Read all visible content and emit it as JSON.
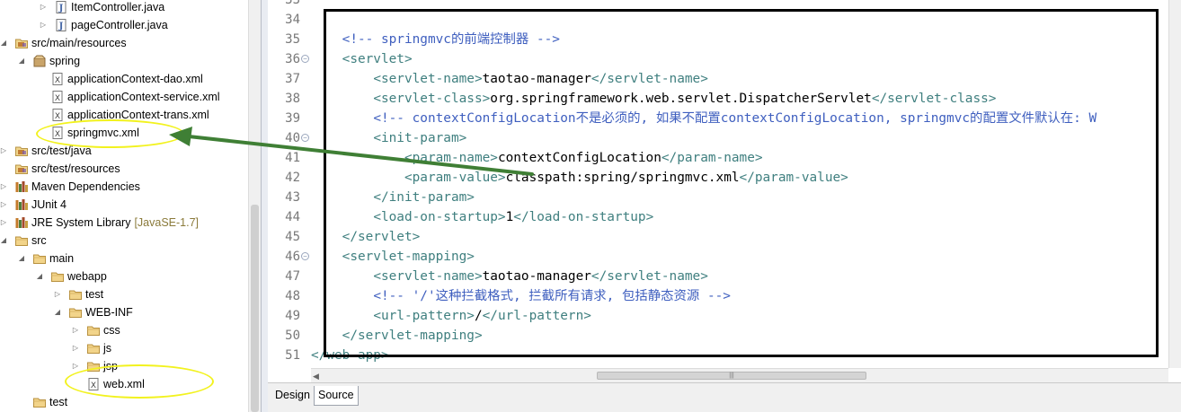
{
  "project_tree": {
    "items": [
      {
        "label": "ItemController.java",
        "icon": "java-file-icon",
        "twisty": "expand",
        "deco": ""
      },
      {
        "label": "pageController.java",
        "icon": "java-file-icon",
        "twisty": "expand",
        "deco": ""
      },
      {
        "label": "src/main/resources",
        "icon": "source-folder-icon",
        "twisty": "collapse",
        "deco": ""
      },
      {
        "label": "spring",
        "icon": "package-icon",
        "twisty": "collapse",
        "deco": ""
      },
      {
        "label": "applicationContext-dao.xml",
        "icon": "xml-file-icon",
        "twisty": "",
        "deco": ""
      },
      {
        "label": "applicationContext-service.xml",
        "icon": "xml-file-icon",
        "twisty": "",
        "deco": ""
      },
      {
        "label": "applicationContext-trans.xml",
        "icon": "xml-file-icon",
        "twisty": "",
        "deco": ""
      },
      {
        "label": "springmvc.xml",
        "icon": "xml-file-icon",
        "twisty": "",
        "deco": ""
      },
      {
        "label": "src/test/java",
        "icon": "source-folder-icon",
        "twisty": "expand",
        "deco": ""
      },
      {
        "label": "src/test/resources",
        "icon": "source-folder-icon",
        "twisty": "",
        "deco": ""
      },
      {
        "label": "Maven Dependencies",
        "icon": "library-icon",
        "twisty": "expand",
        "deco": ""
      },
      {
        "label": "JUnit 4",
        "icon": "library-icon",
        "twisty": "expand",
        "deco": ""
      },
      {
        "label": "JRE System Library",
        "icon": "library-icon",
        "twisty": "expand",
        "deco": "[JavaSE-1.7]"
      },
      {
        "label": "src",
        "icon": "folder-icon",
        "twisty": "collapse",
        "deco": ""
      },
      {
        "label": "main",
        "icon": "folder-icon",
        "twisty": "collapse",
        "deco": ""
      },
      {
        "label": "webapp",
        "icon": "folder-icon",
        "twisty": "collapse",
        "deco": ""
      },
      {
        "label": "test",
        "icon": "folder-icon",
        "twisty": "expand",
        "deco": ""
      },
      {
        "label": "WEB-INF",
        "icon": "folder-icon",
        "twisty": "collapse",
        "deco": ""
      },
      {
        "label": "css",
        "icon": "folder-icon",
        "twisty": "expand",
        "deco": ""
      },
      {
        "label": "js",
        "icon": "folder-icon",
        "twisty": "expand",
        "deco": ""
      },
      {
        "label": "jsp",
        "icon": "folder-icon",
        "twisty": "expand",
        "deco": ""
      },
      {
        "label": "web.xml",
        "icon": "xml-file-icon",
        "twisty": "",
        "deco": ""
      },
      {
        "label": "test",
        "icon": "folder-icon",
        "twisty": "",
        "deco": ""
      }
    ]
  },
  "editor": {
    "lines": [
      {
        "num": "33",
        "fold": false,
        "code": []
      },
      {
        "num": "34",
        "fold": false,
        "code": []
      },
      {
        "num": "35",
        "fold": false,
        "code": [
          {
            "t": "    ",
            "c": "tx"
          },
          {
            "t": "<!-- springmvc的前端控制器 -->",
            "c": "cm"
          }
        ]
      },
      {
        "num": "36",
        "fold": true,
        "code": [
          {
            "t": "    ",
            "c": "tx"
          },
          {
            "t": "<servlet>",
            "c": "tg"
          }
        ]
      },
      {
        "num": "37",
        "fold": false,
        "code": [
          {
            "t": "        ",
            "c": "tx"
          },
          {
            "t": "<servlet-name>",
            "c": "tg"
          },
          {
            "t": "taotao-manager",
            "c": "tx"
          },
          {
            "t": "</servlet-name>",
            "c": "tg"
          }
        ]
      },
      {
        "num": "38",
        "fold": false,
        "code": [
          {
            "t": "        ",
            "c": "tx"
          },
          {
            "t": "<servlet-class>",
            "c": "tg"
          },
          {
            "t": "org.springframework.web.servlet.DispatcherServlet",
            "c": "tx"
          },
          {
            "t": "</servlet-class>",
            "c": "tg"
          }
        ]
      },
      {
        "num": "39",
        "fold": false,
        "code": [
          {
            "t": "        ",
            "c": "tx"
          },
          {
            "t": "<!-- contextConfigLocation不是必须的, 如果不配置contextConfigLocation, springmvc的配置文件默认在: W",
            "c": "cm"
          }
        ]
      },
      {
        "num": "40",
        "fold": true,
        "code": [
          {
            "t": "        ",
            "c": "tx"
          },
          {
            "t": "<init-param>",
            "c": "tg"
          }
        ]
      },
      {
        "num": "41",
        "fold": false,
        "code": [
          {
            "t": "            ",
            "c": "tx"
          },
          {
            "t": "<param-name>",
            "c": "tg"
          },
          {
            "t": "contextConfigLocation",
            "c": "tx"
          },
          {
            "t": "</param-name>",
            "c": "tg"
          }
        ]
      },
      {
        "num": "42",
        "fold": false,
        "code": [
          {
            "t": "            ",
            "c": "tx"
          },
          {
            "t": "<param-value>",
            "c": "tg"
          },
          {
            "t": "classpath:spring/springmvc.xml",
            "c": "tx"
          },
          {
            "t": "</param-value>",
            "c": "tg"
          }
        ]
      },
      {
        "num": "43",
        "fold": false,
        "code": [
          {
            "t": "        ",
            "c": "tx"
          },
          {
            "t": "</init-param>",
            "c": "tg"
          }
        ]
      },
      {
        "num": "44",
        "fold": false,
        "code": [
          {
            "t": "        ",
            "c": "tx"
          },
          {
            "t": "<load-on-startup>",
            "c": "tg"
          },
          {
            "t": "1",
            "c": "tx"
          },
          {
            "t": "</load-on-startup>",
            "c": "tg"
          }
        ]
      },
      {
        "num": "45",
        "fold": false,
        "code": [
          {
            "t": "    ",
            "c": "tx"
          },
          {
            "t": "</servlet>",
            "c": "tg"
          }
        ]
      },
      {
        "num": "46",
        "fold": true,
        "code": [
          {
            "t": "    ",
            "c": "tx"
          },
          {
            "t": "<servlet-mapping>",
            "c": "tg"
          }
        ]
      },
      {
        "num": "47",
        "fold": false,
        "code": [
          {
            "t": "        ",
            "c": "tx"
          },
          {
            "t": "<servlet-name>",
            "c": "tg"
          },
          {
            "t": "taotao-manager",
            "c": "tx"
          },
          {
            "t": "</servlet-name>",
            "c": "tg"
          }
        ]
      },
      {
        "num": "48",
        "fold": false,
        "code": [
          {
            "t": "        ",
            "c": "tx"
          },
          {
            "t": "<!-- '/'这种拦截格式, 拦截所有请求, 包括静态资源 -->",
            "c": "cm"
          }
        ]
      },
      {
        "num": "49",
        "fold": false,
        "code": [
          {
            "t": "        ",
            "c": "tx"
          },
          {
            "t": "<url-pattern>",
            "c": "tg"
          },
          {
            "t": "/",
            "c": "tx"
          },
          {
            "t": "</url-pattern>",
            "c": "tg"
          }
        ]
      },
      {
        "num": "50",
        "fold": false,
        "code": [
          {
            "t": "    ",
            "c": "tx"
          },
          {
            "t": "</servlet-mapping>",
            "c": "tg"
          }
        ]
      },
      {
        "num": "51",
        "fold": false,
        "code": [
          {
            "t": "</web-app>",
            "c": "tg"
          }
        ]
      }
    ],
    "bottom_tabs": {
      "design": "Design",
      "source": "Source"
    }
  },
  "colors": {
    "xml_tag": "#3f7f7f",
    "comment": "#3f5fbf",
    "annotation_highlight": "#f2f21e",
    "annotation_arrow": "#3f7f35"
  }
}
